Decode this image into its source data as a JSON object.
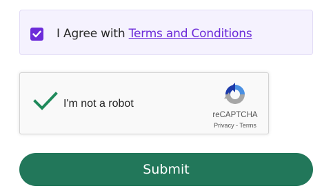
{
  "agreement": {
    "checked": true,
    "prefix": "I Agree with ",
    "link_text": "Terms and Conditions"
  },
  "captcha": {
    "label": "I'm not a robot",
    "verified": true,
    "brand": "reCAPTCHA",
    "privacy_link": "Privacy",
    "separator": " - ",
    "terms_link": "Terms"
  },
  "submit": {
    "label": "Submit"
  },
  "colors": {
    "accent": "#6c2bd9",
    "button": "#22775a",
    "checkmark": "#1f8a5b"
  },
  "icons": {
    "agree_check": "checkmark-icon",
    "captcha_check": "checkmark-icon",
    "recaptcha": "recaptcha-logo-icon"
  }
}
